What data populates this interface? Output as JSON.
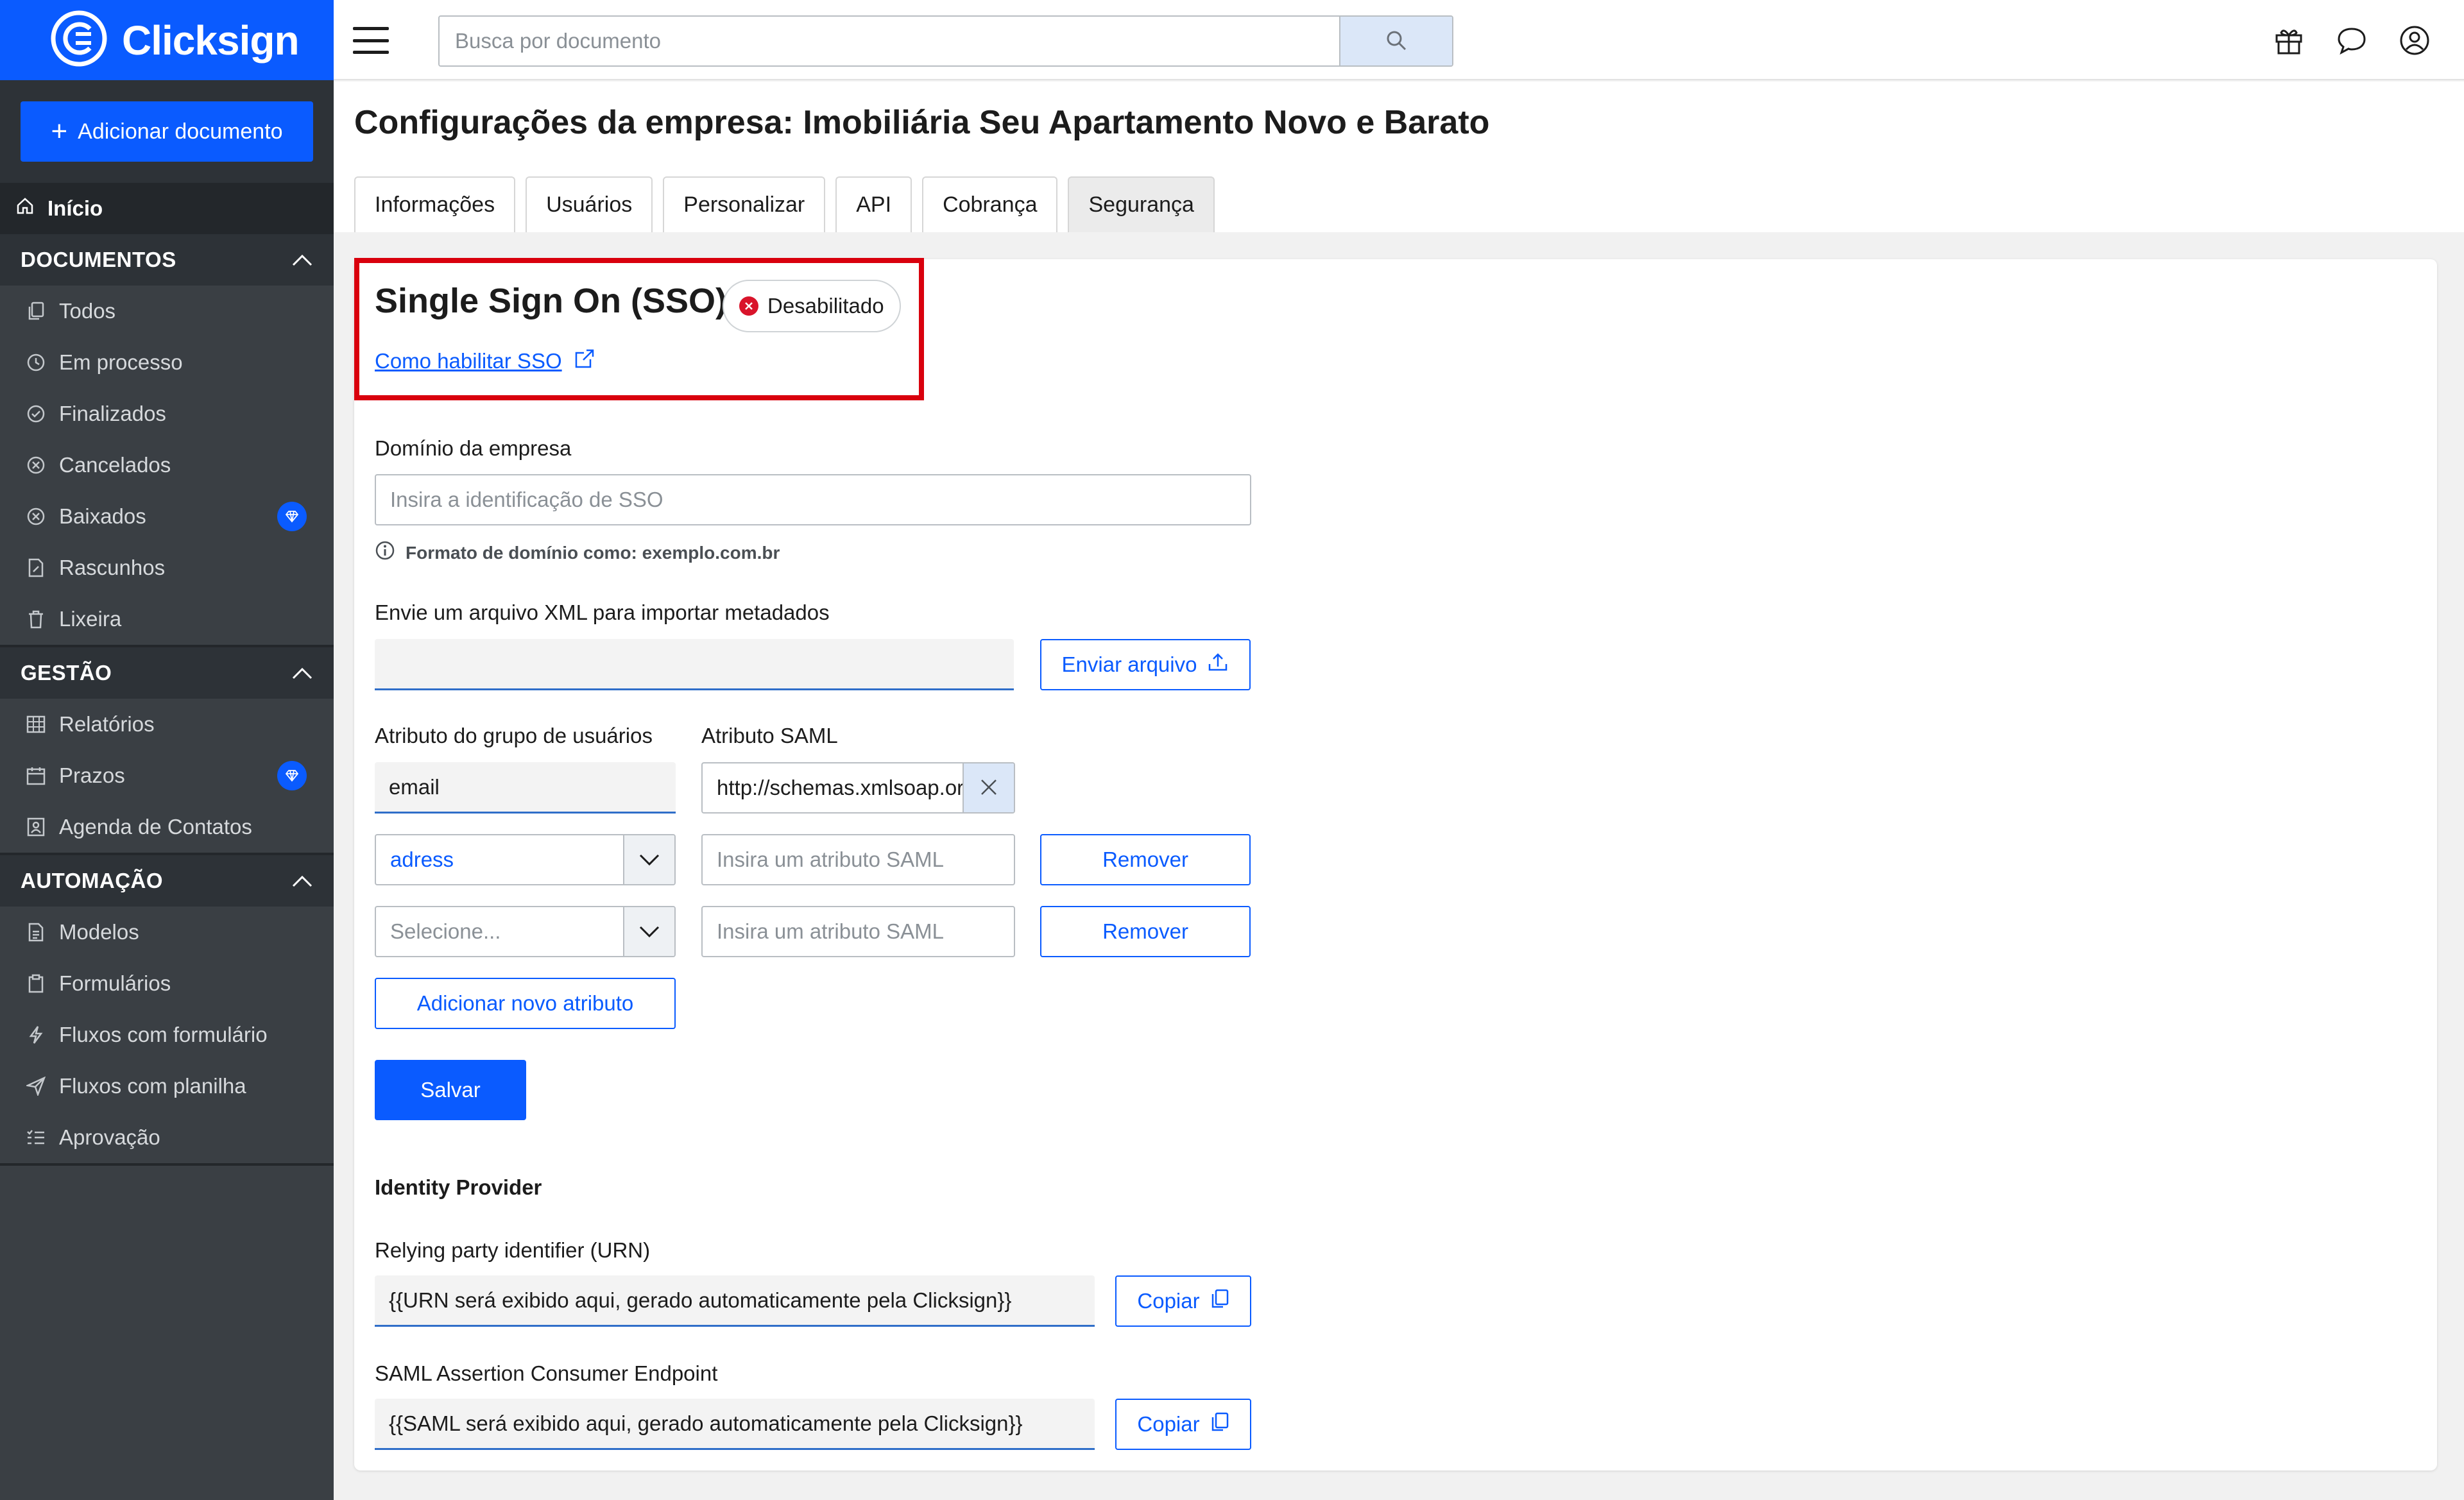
{
  "brand": {
    "name": "Clicksign",
    "primary_color": "#0a5bff",
    "alert_color": "#d9000d"
  },
  "sidebar": {
    "add_document": "Adicionar documento",
    "home": "Início",
    "sections": [
      {
        "title": "DOCUMENTOS",
        "items": [
          {
            "label": "Todos",
            "icon": "copy-icon"
          },
          {
            "label": "Em processo",
            "icon": "clock-icon"
          },
          {
            "label": "Finalizados",
            "icon": "check-circle-icon"
          },
          {
            "label": "Cancelados",
            "icon": "x-circle-icon"
          },
          {
            "label": "Baixados",
            "icon": "x-circle-icon",
            "premium": true
          },
          {
            "label": "Rascunhos",
            "icon": "edit-doc-icon"
          },
          {
            "label": "Lixeira",
            "icon": "trash-icon"
          }
        ]
      },
      {
        "title": "GESTÃO",
        "items": [
          {
            "label": "Relatórios",
            "icon": "table-icon"
          },
          {
            "label": "Prazos",
            "icon": "calendar-icon",
            "premium": true
          },
          {
            "label": "Agenda de Contatos",
            "icon": "contact-icon"
          }
        ]
      },
      {
        "title": "AUTOMAÇÃO",
        "items": [
          {
            "label": "Modelos",
            "icon": "document-icon"
          },
          {
            "label": "Formulários",
            "icon": "clipboard-icon"
          },
          {
            "label": "Fluxos com formulário",
            "icon": "lightning-icon"
          },
          {
            "label": "Fluxos com planilha",
            "icon": "send-icon"
          },
          {
            "label": "Aprovação",
            "icon": "checklist-icon"
          }
        ]
      }
    ]
  },
  "topbar": {
    "search_placeholder": "Busca por documento"
  },
  "page": {
    "title_bold": "Configurações da empresa:",
    "title_company": "Imobiliária Seu Apartamento Novo e Barato",
    "tabs": [
      "Informações",
      "Usuários",
      "Personalizar",
      "API",
      "Cobrança",
      "Segurança"
    ],
    "active_tab": "Segurança"
  },
  "sso": {
    "title": "Single Sign On (SSO)",
    "status": "Desabilitado",
    "help_link": "Como habilitar SSO",
    "domain_label": "Domínio da empresa",
    "domain_placeholder": "Insira a identificação de SSO",
    "domain_hint": "Formato de domínio como: exemplo.com.br",
    "xml_label": "Envie um arquivo XML para importar metadados",
    "xml_value": "",
    "upload_button": "Enviar arquivo",
    "group_attr_label": "Atributo do grupo de usuários",
    "saml_attr_label": "Atributo SAML",
    "attributes": [
      {
        "group": "email",
        "saml": "http://schemas.xmlsoap.org"
      },
      {
        "group": "adress",
        "saml_placeholder": "Insira um atributo SAML",
        "remove": "Remover"
      },
      {
        "group_placeholder": "Selecione...",
        "saml_placeholder": "Insira um atributo SAML",
        "remove": "Remover"
      }
    ],
    "add_attribute": "Adicionar novo atributo",
    "save": "Salvar"
  },
  "idp": {
    "title": "Identity Provider",
    "urn_label": "Relying party identifier (URN)",
    "urn_value": "{{URN será exibido aqui, gerado automaticamente pela Clicksign}}",
    "acs_label": "SAML Assertion Consumer Endpoint",
    "acs_value": "{{SAML será exibido aqui, gerado automaticamente pela Clicksign}}",
    "copy": "Copiar"
  }
}
